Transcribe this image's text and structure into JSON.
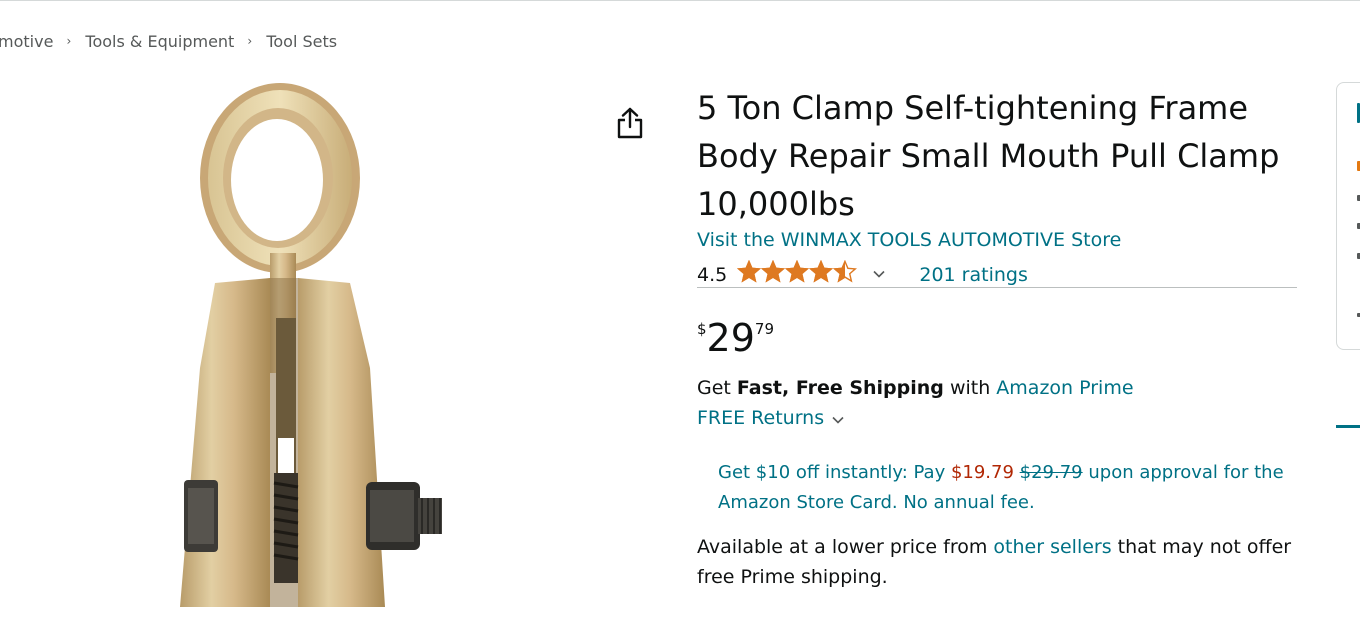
{
  "breadcrumb": {
    "items": [
      "motive",
      "Tools & Equipment",
      "Tool Sets"
    ],
    "separator": "›"
  },
  "product": {
    "title": "5 Ton Clamp Self-tightening Frame Body Repair Small Mouth Pull Clamp 10,000lbs",
    "store_link": "Visit the WINMAX TOOLS AUTOMOTIVE Store",
    "rating_value": "4.5",
    "rating_stars": 4.5,
    "ratings_count": "201 ratings",
    "image_icon": "pull-clamp-photo"
  },
  "price": {
    "symbol": "$",
    "whole": "29",
    "fraction": "79"
  },
  "shipping": {
    "prefix": "Get ",
    "bold": "Fast, Free Shipping",
    "middle": " with ",
    "prime_link": "Amazon Prime",
    "returns": "FREE Returns"
  },
  "promo": {
    "text1": "Get $10 off instantly: Pay ",
    "new_price": "$19.79",
    "space": " ",
    "old_price": "$29.79",
    "text2": " upon approval for the Amazon Store Card. No annual fee."
  },
  "availability": {
    "text1": "Available at a lower price from ",
    "link": "other sellers",
    "text2": " that may not offer free Prime shipping."
  },
  "icons": {
    "share": "share-icon",
    "chevron": "chevron-down-icon",
    "star": "star-icon"
  },
  "colors": {
    "link": "#007185",
    "star": "#de7921",
    "price_red": "#b12704",
    "text": "#0f1111"
  }
}
